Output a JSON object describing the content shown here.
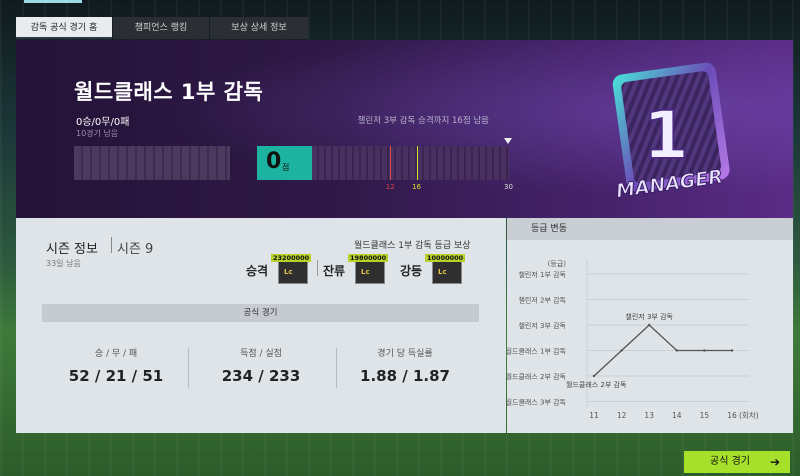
{
  "tabs": [
    {
      "label": "감독 공식 경기 홈"
    },
    {
      "label": "챔피언스 랭킹"
    },
    {
      "label": "보상 상세 정보"
    }
  ],
  "banner": {
    "title": "월드클래스 1부 감독",
    "record": "0승/0무/0패",
    "games_left": "10경기 남음",
    "promotion": "챌린저 3부 감독 승격까지 16점 남음",
    "points_value": "0",
    "points_unit": "점",
    "points_fraction": 0,
    "marks": [
      {
        "label": "12",
        "color": "#e04848",
        "value": 12
      },
      {
        "label": "16",
        "color": "#d6e02a",
        "value": 16
      },
      {
        "label": "30",
        "color": "#eeeeee",
        "value": 30
      }
    ],
    "emblem_number": "1",
    "emblem_text": "MANAGER"
  },
  "season": {
    "title": "시즌 정보",
    "season_label": "시즌 9",
    "days_left": "33일 남음",
    "reward_title": "월드클래스 1부 감독 등급 보상",
    "rewards": [
      {
        "label": "승격",
        "amount": "23200000",
        "icon_text": "Lc"
      },
      {
        "label": "잔류",
        "amount": "19800000",
        "icon_text": "Lc"
      },
      {
        "label": "강등",
        "amount": "10000000",
        "icon_text": "Lc"
      }
    ],
    "section_title": "공식 경기",
    "stats": [
      {
        "label": "승 / 무 / 패",
        "value": "52 / 21 / 51"
      },
      {
        "label": "득점 / 실점",
        "value": "234 / 233"
      },
      {
        "label": "경기 당 득실률",
        "value": "1.88 / 1.87"
      }
    ]
  },
  "grade_change": {
    "title": "등급 변동",
    "y_unit": "(등급)",
    "x_unit": "(회차)"
  },
  "chart_data": {
    "type": "line",
    "categories": [
      "챌린저 1부 감독",
      "챌린저 2부 감독",
      "챌린저 3부 감독",
      "월드클래스 1부 감독",
      "월드클래스 2부 감독",
      "월드클래스 3부 감독"
    ],
    "x": [
      11,
      12,
      13,
      14,
      15,
      16
    ],
    "series": [
      {
        "values": [
          "월드클래스 2부 감독",
          "월드클래스 1부 감독",
          "챌린저 3부 감독",
          "월드클래스 1부 감독",
          "월드클래스 1부 감독",
          "월드클래스 1부 감독"
        ]
      }
    ],
    "annotations": [
      {
        "x": 11,
        "text": "월드클래스 2부 감독"
      },
      {
        "x": 13,
        "text": "챌린저 3부 감독"
      }
    ],
    "x_tick_labels": [
      "11",
      "12",
      "13",
      "14",
      "15",
      "16"
    ],
    "grid": true
  },
  "buttons": {
    "official_match": "공식 경기",
    "arrow": "➔"
  }
}
